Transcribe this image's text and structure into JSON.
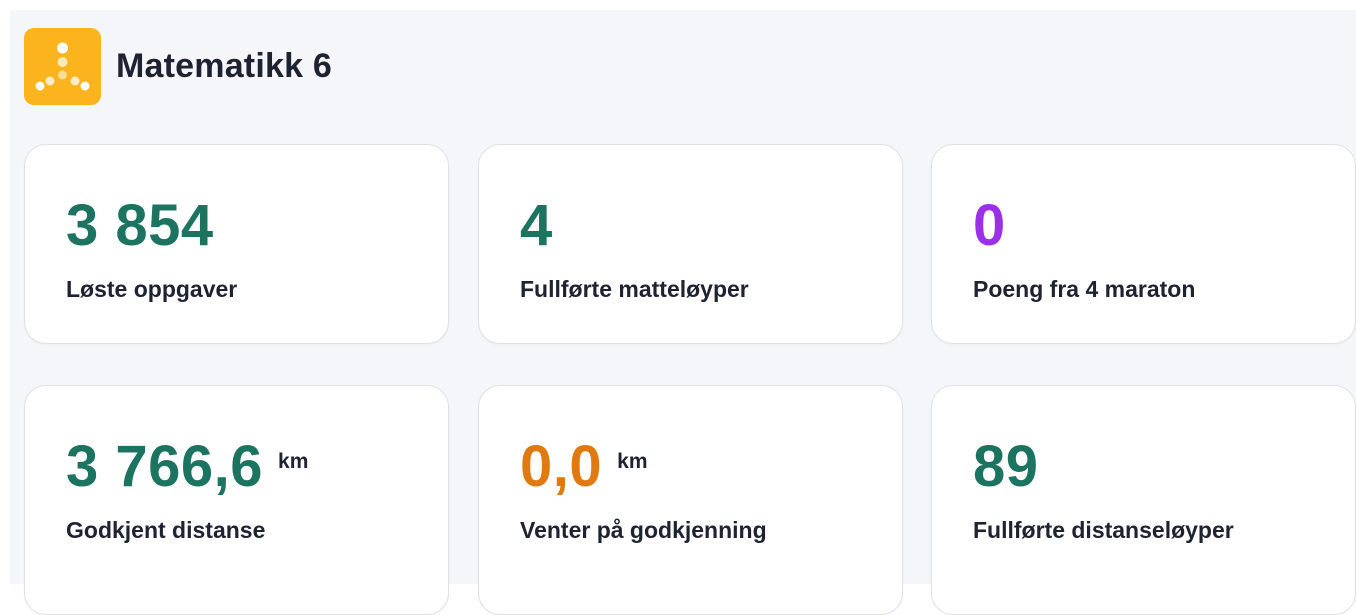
{
  "header": {
    "title": "Matematikk 6",
    "logo_icon": "dots-triangle-icon",
    "logo_color": "#fbb41e"
  },
  "colors": {
    "green": "#1c7460",
    "purple": "#9b30e8",
    "orange": "#e07a10",
    "text": "#1e2231"
  },
  "stats": [
    {
      "value": "3 854",
      "unit": "",
      "label": "Løste oppgaver",
      "color": "#1c7460"
    },
    {
      "value": "4",
      "unit": "",
      "label": "Fullførte matteløyper",
      "color": "#1c7460"
    },
    {
      "value": "0",
      "unit": "",
      "label": "Poeng fra 4 maraton",
      "color": "#9b30e8"
    },
    {
      "value": "3 766,6",
      "unit": "km",
      "label": "Godkjent distanse",
      "color": "#1c7460"
    },
    {
      "value": "0,0",
      "unit": "km",
      "label": "Venter på godkjenning",
      "color": "#e07a10"
    },
    {
      "value": "89",
      "unit": "",
      "label": "Fullførte distanseløyper",
      "color": "#1c7460"
    }
  ]
}
